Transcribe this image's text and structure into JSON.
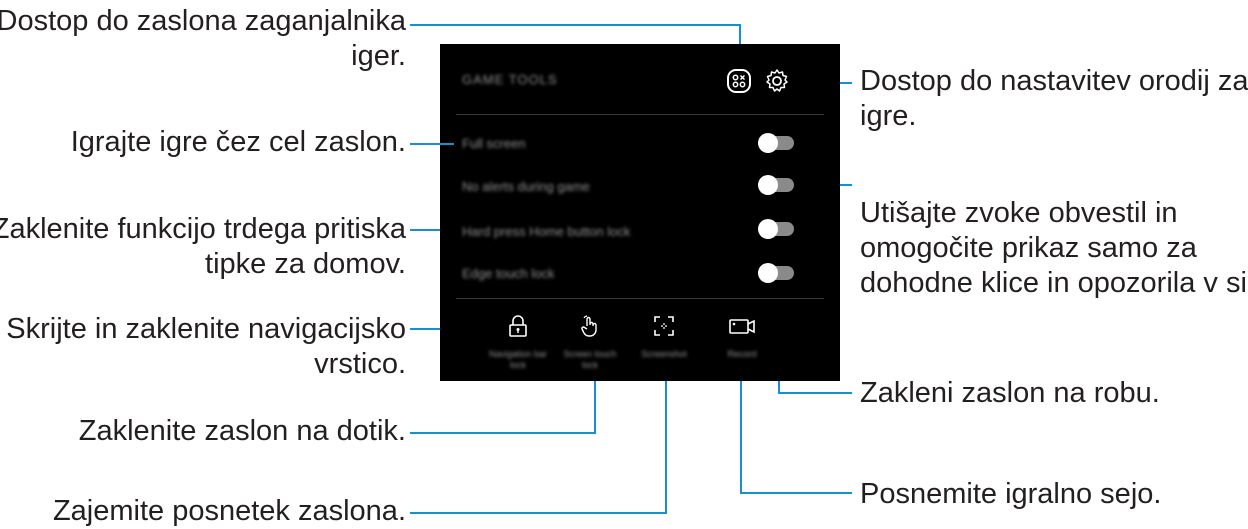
{
  "annotations": {
    "game_launcher": "Dostop do zaslona zaganjalnika\niger.",
    "full_screen": "Igrajte igre čez cel zaslon.",
    "home_button": "Zaklenite funkcijo trdega pritiska\ntipke za domov.",
    "nav_bar": "Skrijte in zaklenite navigacijsko\nvrstico.",
    "touch_lock": "Zaklenite zaslon na dotik.",
    "screenshot": "Zajemite posnetek zaslona.",
    "settings": "Dostop do nastavitev orodij za\nigre.",
    "no_alerts": "Utišajte zvoke obvestil in\nomogočite prikaz samo za\ndohodne klice in opozorila v sili.",
    "edge_lock": "Zakleni zaslon na robu.",
    "record": "Posnemite igralno sejo."
  },
  "phone": {
    "title": "GAME TOOLS",
    "rows": [
      {
        "label": "Full screen",
        "toggle": "off"
      },
      {
        "label": "No alerts during game",
        "toggle": "off"
      },
      {
        "label": "Hard press Home button lock",
        "toggle": "off"
      },
      {
        "label": "Edge touch lock",
        "toggle": "off"
      }
    ],
    "bottom": [
      {
        "label": "Navigation bar lock",
        "icon": "lock-icon"
      },
      {
        "label": "Screen touch lock",
        "icon": "touch-hand-icon"
      },
      {
        "label": "Screenshot",
        "icon": "screenshot-icon"
      },
      {
        "label": "Record",
        "icon": "record-icon"
      }
    ],
    "header_icons": [
      "game-launcher-icon",
      "gear-icon"
    ]
  },
  "colors": {
    "callout_line": "#1a8fd0",
    "phone_bg": "#000000",
    "text": "#231f20"
  }
}
